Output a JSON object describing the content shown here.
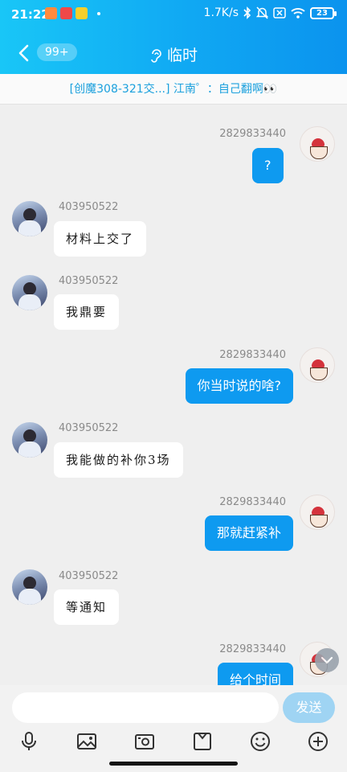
{
  "status_bar": {
    "time": "21:22",
    "network_speed": "1.7K/s",
    "battery": "23"
  },
  "header": {
    "unread_count": "99+",
    "title": "临时",
    "gradient_colors": [
      "#19c6f7",
      "#0b93ee"
    ]
  },
  "notice": {
    "text": "[创魔308-321交...] 江南゜：自己翻啊👀"
  },
  "messages": [
    {
      "side": "self",
      "sender": "2829833440",
      "text": "?"
    },
    {
      "side": "other",
      "sender": "403950522",
      "text": "材料上交了"
    },
    {
      "side": "other",
      "sender": "403950522",
      "text": "我鼎要"
    },
    {
      "side": "self",
      "sender": "2829833440",
      "text": "你当时说的啥?"
    },
    {
      "side": "other",
      "sender": "403950522",
      "text": "我能做的补你3场"
    },
    {
      "side": "self",
      "sender": "2829833440",
      "text": "那就赶紧补"
    },
    {
      "side": "other",
      "sender": "403950522",
      "text": "等通知"
    },
    {
      "side": "self",
      "sender": "2829833440",
      "text": "给个时间"
    }
  ],
  "input": {
    "value": "",
    "placeholder": "",
    "send_label": "发送"
  },
  "toolbar_icons": [
    "microphone-icon",
    "image-icon",
    "camera-icon",
    "file-icon",
    "emoji-icon",
    "plus-icon"
  ],
  "colors": {
    "self_bubble": "#0e9af0",
    "other_bubble": "#ffffff",
    "background": "#efefef"
  }
}
